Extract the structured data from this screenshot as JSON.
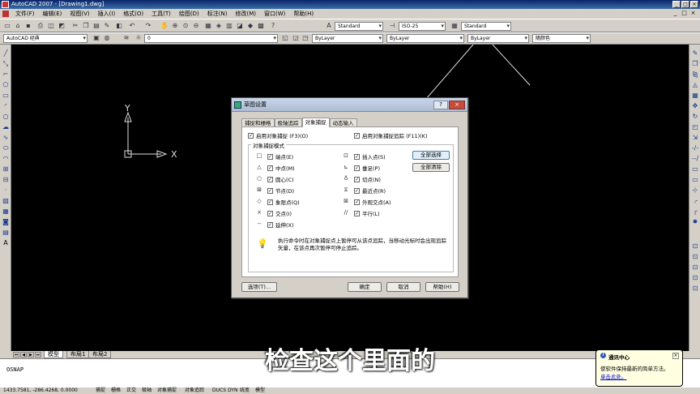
{
  "window": {
    "title": "AutoCAD 2007 - [Drawing1.dwg]",
    "controls": [
      "_",
      "□",
      "×"
    ]
  },
  "menubar": {
    "items": [
      "文件(F)",
      "编辑(E)",
      "视图(V)",
      "插入(I)",
      "格式(O)",
      "工具(T)",
      "绘图(D)",
      "标注(N)",
      "修改(M)",
      "窗口(W)",
      "帮助(H)"
    ],
    "doc_controls": [
      "_",
      "□",
      "×"
    ]
  },
  "toolbars": {
    "text_style": "Standard",
    "dim_style": "ISO-25",
    "table_style": "Standard",
    "workspace": "AutoCAD 经典",
    "layer": "0",
    "color": "ByLayer",
    "linetype": "ByLayer",
    "lineweight": "ByLayer",
    "plot_style": "随颜色"
  },
  "ucs": {
    "x_label": "X",
    "y_label": "Y"
  },
  "tabs": {
    "model": "模型",
    "layout1": "布局1",
    "layout2": "布局2"
  },
  "command": {
    "text": "OSNAP"
  },
  "status": {
    "coords": "1433.7581, -286.4268, 0.0000",
    "buttons": [
      "捕捉",
      "栅格",
      "正交",
      "极轴",
      "对象捕捉",
      "对象追踪",
      "DUCS",
      "DYN",
      "线宽",
      "模型"
    ]
  },
  "subtitle": "检查这个里面的",
  "notification": {
    "title": "通讯中心",
    "body": "使软件保持最新的简单方法。",
    "link": "单击此处。",
    "close": "×"
  },
  "dialog": {
    "title": "草图设置",
    "help": "?",
    "close": "×",
    "tabs": [
      "捕捉和栅格",
      "极轴追踪",
      "对象捕捉",
      "动态输入"
    ],
    "active_tab": 2,
    "enable_osnap": "启用对象捕捉 (F3)(O)",
    "enable_tracking": "启用对象捕捉追踪 (F11)(K)",
    "group_label": "对象捕捉模式",
    "modes_left": [
      {
        "symbol": "□",
        "label": "端点(E)",
        "checked": true
      },
      {
        "symbol": "△",
        "label": "中点(M)",
        "checked": true
      },
      {
        "symbol": "○",
        "label": "圆心(C)",
        "checked": true
      },
      {
        "symbol": "⊠",
        "label": "节点(D)",
        "checked": true
      },
      {
        "symbol": "◇",
        "label": "象限点(Q)",
        "checked": true
      },
      {
        "symbol": "×",
        "label": "交点(I)",
        "checked": true
      },
      {
        "symbol": "--",
        "label": "延伸(X)",
        "checked": true
      }
    ],
    "modes_right": [
      {
        "symbol": "⊡",
        "label": "插入点(S)",
        "checked": true
      },
      {
        "symbol": "⊾",
        "label": "垂足(P)",
        "checked": true
      },
      {
        "symbol": "♁",
        "label": "切点(N)",
        "checked": true
      },
      {
        "symbol": "⧖",
        "label": "最近点(R)",
        "checked": true
      },
      {
        "symbol": "⊠",
        "label": "外观交点(A)",
        "checked": true
      },
      {
        "symbol": "//",
        "label": "平行(L)",
        "checked": true
      }
    ],
    "check_mark": "✓",
    "select_all": "全部选择",
    "clear_all": "全部清除",
    "tip": "执行命令时在对象捕捉点上暂停可从该点追踪，当移动光标时会出现追踪矢量，在该点再次暂停可停止追踪。",
    "options_button": "选项(T)...",
    "ok_button": "确定",
    "cancel_button": "取消",
    "help_button": "帮助(H)"
  }
}
